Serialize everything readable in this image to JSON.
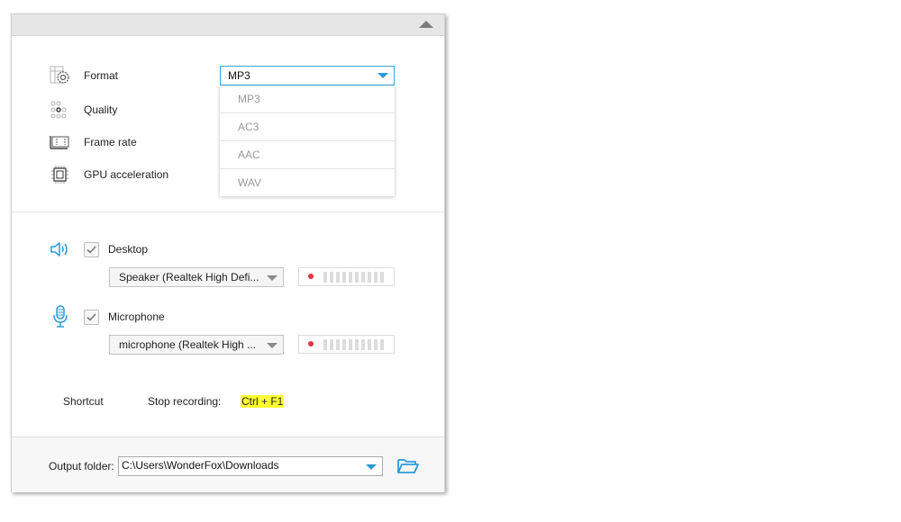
{
  "settings": {
    "format": {
      "label": "Format",
      "icon": "format-gear-icon",
      "selected": "MP3",
      "options": [
        "MP3",
        "AC3",
        "AAC",
        "WAV"
      ]
    },
    "quality": {
      "label": "Quality",
      "icon": "quality-dots-icon"
    },
    "frame_rate": {
      "label": "Frame rate",
      "icon": "frame-rate-icon"
    },
    "gpu": {
      "label": "GPU acceleration",
      "icon": "gpu-chip-icon"
    }
  },
  "audio": {
    "desktop": {
      "label": "Desktop",
      "checked": true,
      "icon": "speaker-icon",
      "device": "Speaker (Realtek High Defi..."
    },
    "microphone": {
      "label": "Microphone",
      "checked": true,
      "icon": "microphone-icon",
      "device": "microphone (Realtek High ..."
    }
  },
  "shortcut": {
    "label": "Shortcut",
    "action": "Stop recording:",
    "keys": "Ctrl + F1"
  },
  "output": {
    "label": "Output folder:",
    "path": "C:\\Users\\WonderFox\\Downloads"
  },
  "colors": {
    "accent": "#2a9ad8",
    "highlight": "#ffff33",
    "record_dot": "#e0383b"
  }
}
